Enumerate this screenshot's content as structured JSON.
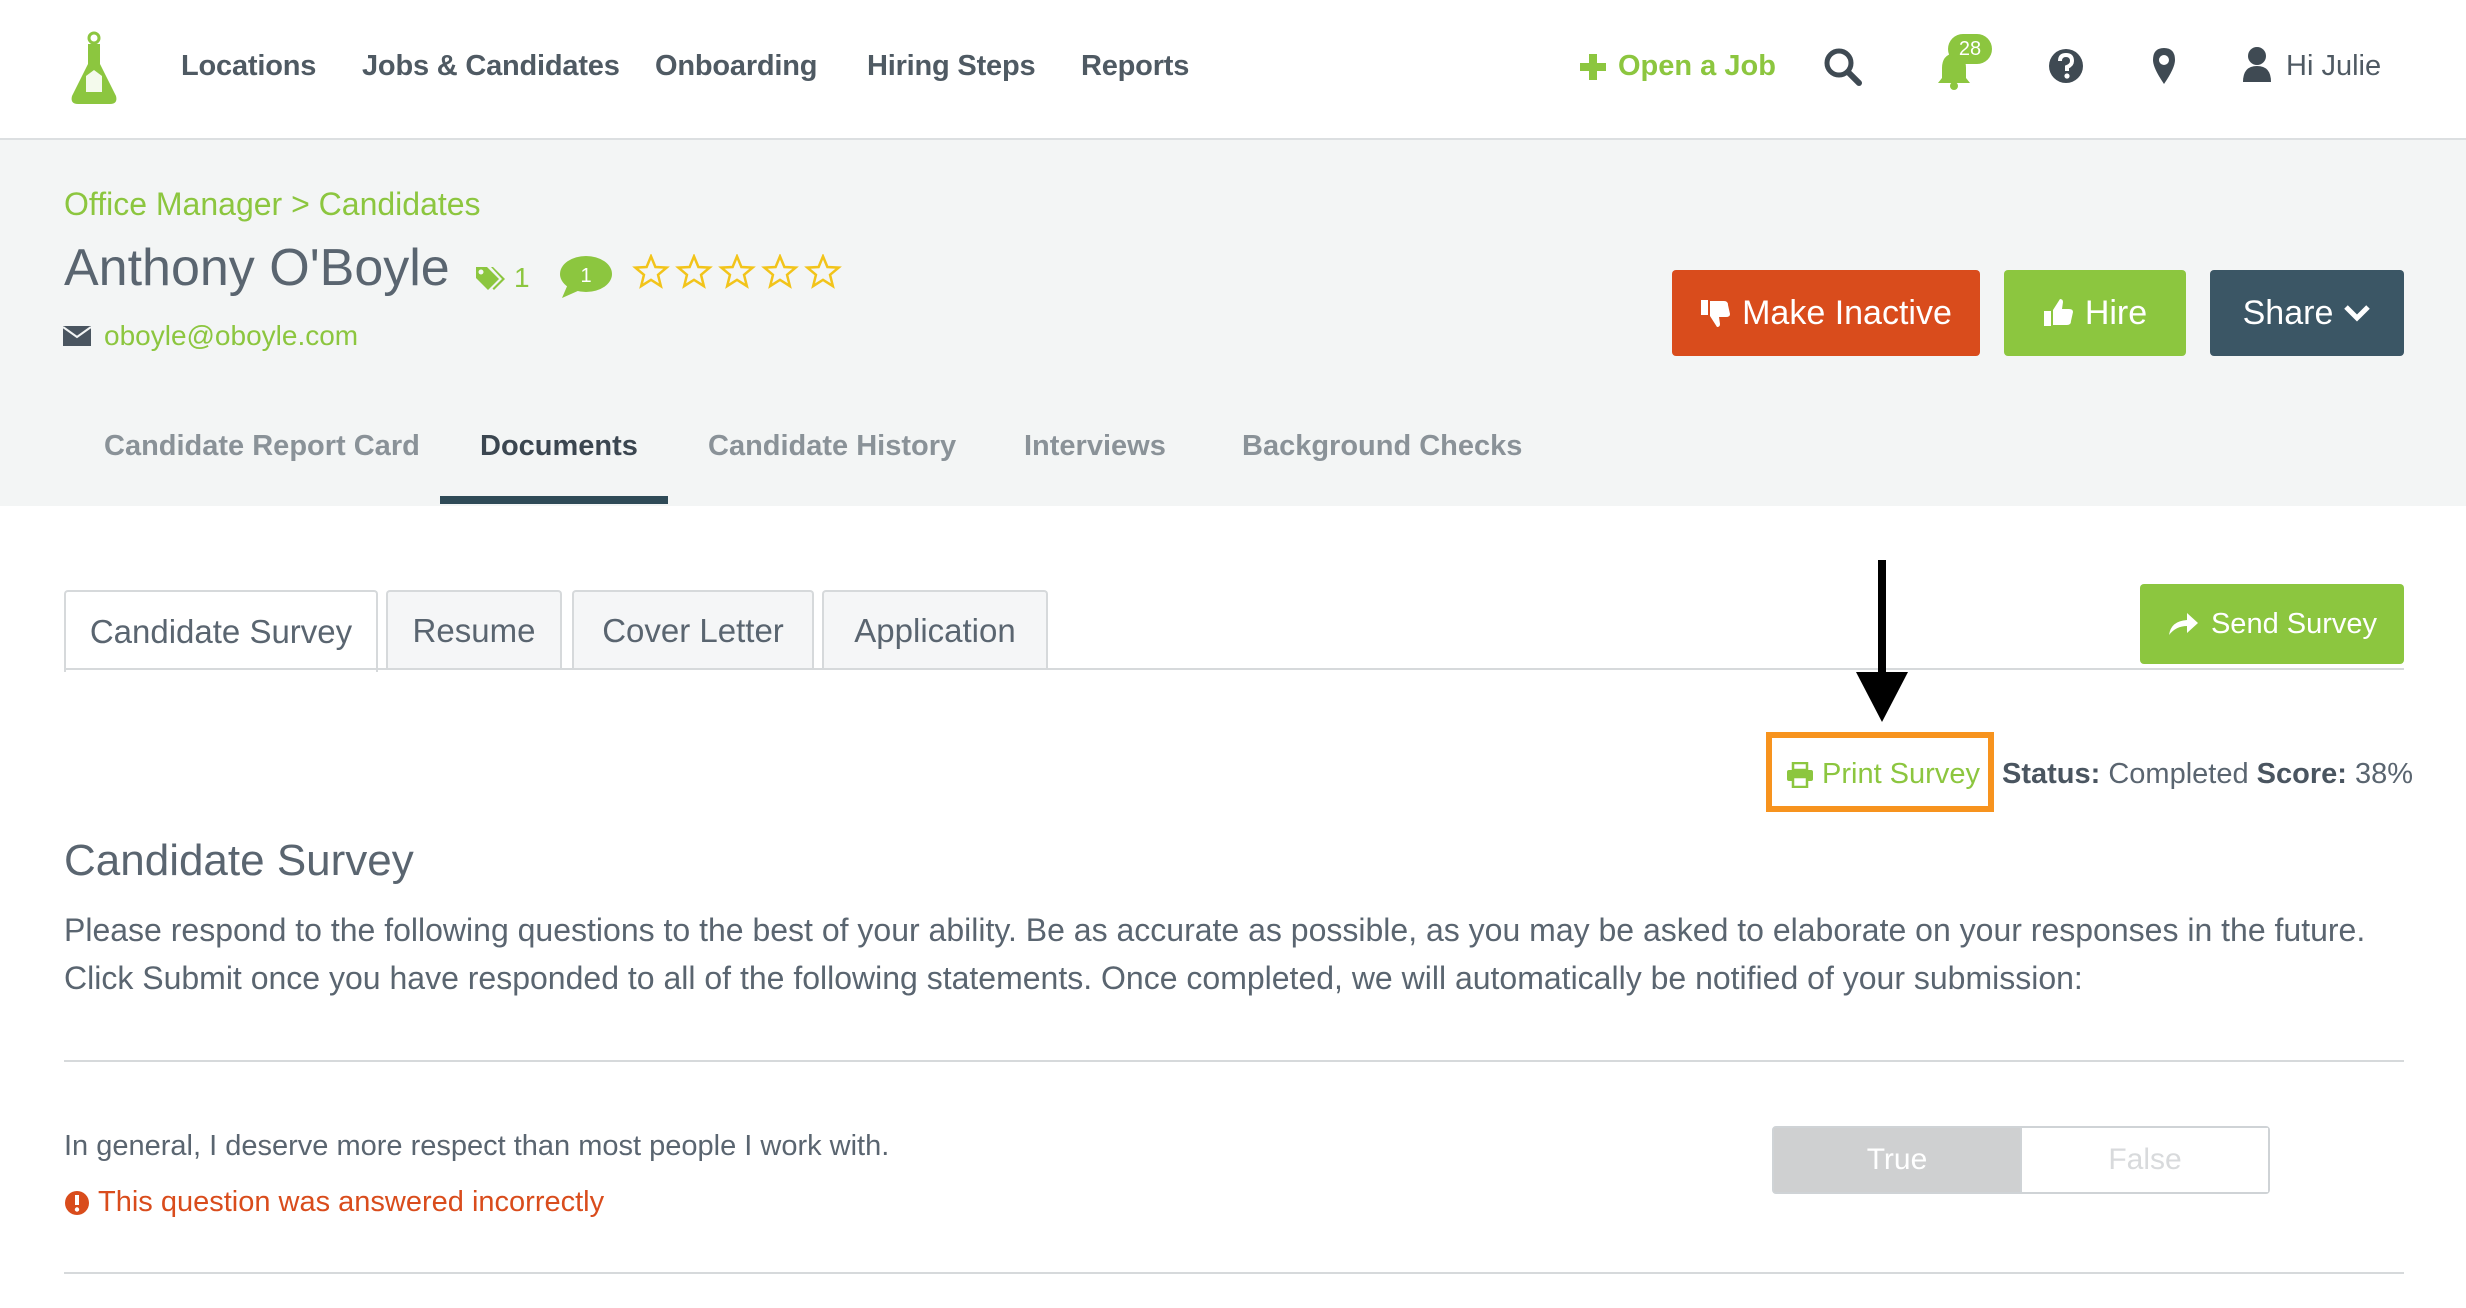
{
  "nav": {
    "items": [
      "Locations",
      "Jobs & Candidates",
      "Onboarding",
      "Hiring Steps",
      "Reports"
    ],
    "open_job": "Open a Job",
    "notification_count": "28",
    "greeting": "Hi Julie"
  },
  "header": {
    "breadcrumb": "Office Manager > Candidates",
    "candidate_name": "Anthony O'Boyle",
    "tag_count": "1",
    "comment_count": "1",
    "rating": 0,
    "email": "oboyle@oboyle.com",
    "buttons": {
      "inactive": "Make Inactive",
      "hire": "Hire",
      "share": "Share"
    },
    "tabs": [
      "Candidate Report Card",
      "Documents",
      "Candidate History",
      "Interviews",
      "Background Checks"
    ],
    "active_tab": "Documents"
  },
  "documents": {
    "tabs": [
      "Candidate Survey",
      "Resume",
      "Cover Letter",
      "Application"
    ],
    "active_tab": "Candidate Survey",
    "send_survey": "Send Survey",
    "print_survey": "Print Survey",
    "status_label": "Status:",
    "status_value": "Completed",
    "score_label": "Score:",
    "score_value": "38%"
  },
  "survey": {
    "title": "Candidate Survey",
    "description": "Please respond to the following questions to the best of your ability. Be as accurate as possible, as you may be asked to elaborate on your responses in the future. Click Submit once you have responded to all of the following statements. Once completed, we will automatically be notified of your submission:",
    "question": "In general, I deserve more respect than most people I work with.",
    "incorrect_note": "This question was answered incorrectly",
    "true_label": "True",
    "false_label": "False",
    "selected": "True"
  },
  "colors": {
    "brand_green": "#8cc63f",
    "danger": "#d94c1c",
    "dark_slate": "#3b5665",
    "highlight": "#f7931e"
  }
}
